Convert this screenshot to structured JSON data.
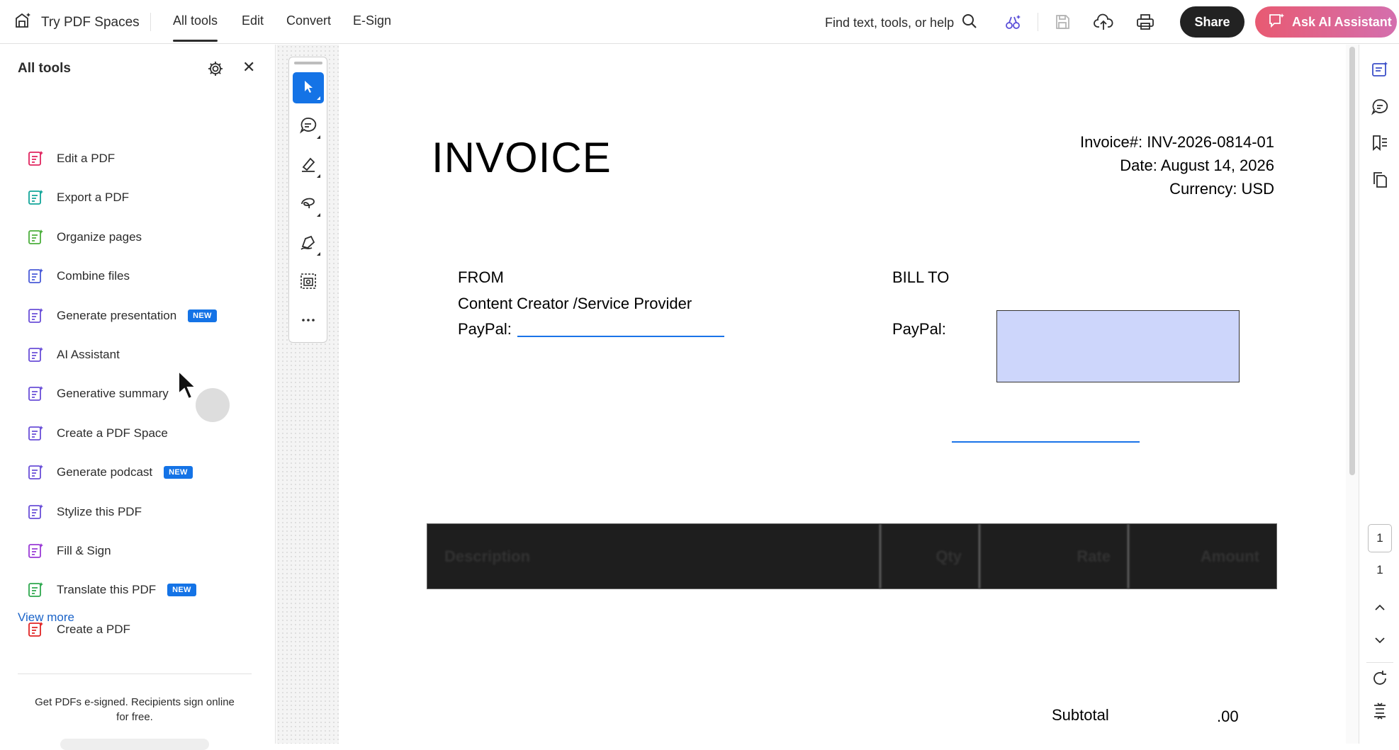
{
  "topbar": {
    "brand_label": "Try PDF Spaces",
    "tabs": [
      {
        "label": "All tools",
        "active": true
      },
      {
        "label": "Edit",
        "active": false
      },
      {
        "label": "Convert",
        "active": false
      },
      {
        "label": "E-Sign",
        "active": false
      }
    ],
    "search_label": "Find text, tools, or help",
    "share_label": "Share",
    "ai_label": "Ask AI Assistant",
    "icons": [
      "pdf-spaces-icon",
      "search-icon",
      "ai-tools-icon",
      "save-icon",
      "upload-icon",
      "print-icon",
      "ai-assistant-icon"
    ],
    "colors": {
      "share_bg": "#222222",
      "ai_gradient_start": "#e85a72",
      "ai_gradient_end": "#d46fae"
    }
  },
  "left_panel": {
    "title": "All tools",
    "tools": [
      {
        "label": "Edit a PDF",
        "icon": "edit-pdf-icon",
        "badge": "",
        "color": "#e0245e"
      },
      {
        "label": "Export a PDF",
        "icon": "export-pdf-icon",
        "badge": "",
        "color": "#12a69a"
      },
      {
        "label": "Organize pages",
        "icon": "organize-pages-icon",
        "badge": "",
        "color": "#4caf3c"
      },
      {
        "label": "Combine files",
        "icon": "combine-files-icon",
        "badge": "",
        "color": "#4a5bd8"
      },
      {
        "label": "Generate presentation",
        "icon": "generate-presentation-icon",
        "badge": "NEW",
        "color": "#6a4fd8"
      },
      {
        "label": "AI Assistant",
        "icon": "ai-assistant-icon",
        "badge": "",
        "color": "#6a4fd8"
      },
      {
        "label": "Generative summary",
        "icon": "generative-summary-icon",
        "badge": "",
        "color": "#6a4fd8"
      },
      {
        "label": "Create a PDF Space",
        "icon": "pdf-space-icon",
        "badge": "",
        "color": "#6a4fd8"
      },
      {
        "label": "Generate podcast",
        "icon": "podcast-icon",
        "badge": "NEW",
        "color": "#6a4fd8"
      },
      {
        "label": "Stylize this PDF",
        "icon": "stylize-icon",
        "badge": "",
        "color": "#6a4fd8"
      },
      {
        "label": "Fill & Sign",
        "icon": "fill-sign-icon",
        "badge": "",
        "color": "#9a3bd6"
      },
      {
        "label": "Translate this PDF",
        "icon": "translate-icon",
        "badge": "NEW",
        "color": "#2fa84f"
      },
      {
        "label": "Create a PDF",
        "icon": "create-pdf-icon",
        "badge": "",
        "color": "#e02424"
      }
    ],
    "view_more": "View more",
    "promo": "Get PDFs e-signed. Recipients sign online for free."
  },
  "quick_tools": [
    "select-icon",
    "comment-icon",
    "highlight-icon",
    "draw-icon",
    "signature-icon",
    "snapshot-icon",
    "more-icon"
  ],
  "document": {
    "title": "INVOICE",
    "invoice_number": "Invoice#: INV-2026-0814-01",
    "date": "Date: August 14, 2026",
    "currency": "Currency: USD",
    "from_label": "FROM",
    "from_name": "Content Creator /Service Provider",
    "from_paypal": "PayPal:",
    "bill_label": "BILL TO",
    "bill_paypal": "PayPal:",
    "table_headers": [
      "Description",
      "Qty",
      "Rate",
      "Amount"
    ],
    "subtotal_label": "Subtotal",
    "subtotal_value": ".00"
  },
  "page_nav": {
    "current": "1",
    "total": "1"
  },
  "right_rail_icons": [
    "ai-summary-icon",
    "comments-icon",
    "bookmarks-icon",
    "pages-icon",
    "chevron-up-icon",
    "chevron-down-icon",
    "refresh-icon",
    "fit-page-icon"
  ]
}
